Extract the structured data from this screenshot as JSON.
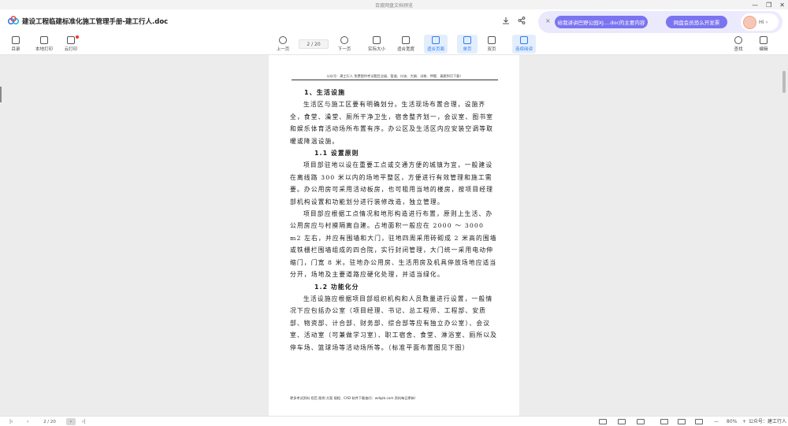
{
  "window": {
    "app_title": "百度网盘文档预览",
    "minimize": "—",
    "restore": "❐",
    "close": "✕"
  },
  "header": {
    "doc_title": "建设工程临建标准化施工管理手册-建工行人.doc",
    "promo": {
      "close": "×",
      "ai_pill": "给我讲讲巴野公园XJ....doc的主要内容",
      "vip_pill": "网盘会员恐么开发票",
      "hi_label": "Hi ›"
    }
  },
  "toolbar": {
    "left": [
      {
        "label": "目录",
        "icon": "toc-icon"
      },
      {
        "label": "本地打印",
        "icon": "printer-icon"
      },
      {
        "label": "云打印",
        "icon": "cloud-print-icon"
      }
    ],
    "prev_label": "上一页",
    "page_value": "2 / 20",
    "next_label": "下一页",
    "view_buttons": [
      {
        "label": "实际大小",
        "icon": "actual-size-icon",
        "active": false
      },
      {
        "label": "适合宽度",
        "icon": "fit-width-icon",
        "active": false
      },
      {
        "label": "适合页面",
        "icon": "fit-page-icon",
        "active": true
      },
      {
        "label": "单页",
        "icon": "single-page-icon",
        "active": true
      },
      {
        "label": "双页",
        "icon": "double-page-icon",
        "active": false
      },
      {
        "label": "连续阅读",
        "icon": "continuous-icon",
        "active": true
      }
    ],
    "right": [
      {
        "label": "查找",
        "icon": "search-icon"
      },
      {
        "label": "编辑",
        "icon": "edit-icon"
      }
    ]
  },
  "document": {
    "page_header": "公众号：建工行人 免费提供考试题目全级、管道、口诀、大纲、试卷、押题、真题到可下载！",
    "heading1": "1、生活设施",
    "para1": "生活区与施工区要有明确划分。生活现场布置合理，设施齐全，食堂、澡堂、厕所干净卫生，宿舍整齐划一，会议室、图书室和娱乐体育活动场所布置有序。办公区及生活区内应安装空调等取暖或降温设施。",
    "heading2": "1.1 设置原则",
    "para2": "项目部驻地以设在重要工点或交通方便的城镇为宜，一般建设在离线路 300 米以内的场地平整区，方便进行有效管理和施工需要。办公用房可采用活动板房，也可租用当地的楼房，按项目经理部机构设置和功能划分进行装修改造，独立管理。",
    "para3": "项目部应根据工点情况和地形构造进行布置，原则上生活、办公用房应与村摸隔离自建。占地面积一般应在 2000 ～ 3000 m2 左右，并应有围墙和大门，驻地四周采用砖砌成 2 米高的围墙或铁栅栏围墙组成的四合院，实行封闭管理，大门统一采用电动伸缩门，门宽 8 米。驻地办公用房、生活用房及机具停放场地应适当分开，场地及主要道路应硬化处理，并适当绿化。",
    "heading3": "1.2 功能化分",
    "para4": "生活设施应根据项目部组织机构和人员数量进行设置，一般情况下应包括办公室（项目经理、书记、总工程师、工程部、安质部、物资部、计合部、财务部、综合部等应有独立办公室）、会议室、活动室（可兼做学习室）、职工宿舍、食堂、淋浴室、厕所以及停车场、篮球场等活动场所等。（标准平面布置图见下图）",
    "page_footer": "更多考试资料 招范 图例 方案 规程、CAD 软件下载查问：wdqzk.com 资料每日更新！"
  },
  "statusbar": {
    "first": "|‹",
    "prev": "‹",
    "page_value": "2 / 20",
    "next": "›",
    "last": "›|",
    "zoom_out": "—",
    "zoom_value": "80%",
    "zoom_in": "+",
    "watermark": "公众号：建工行人"
  },
  "colors": {
    "accent": "#2f7cf6",
    "promo_pill": "#7b74f0",
    "workspace": "#ececec"
  }
}
